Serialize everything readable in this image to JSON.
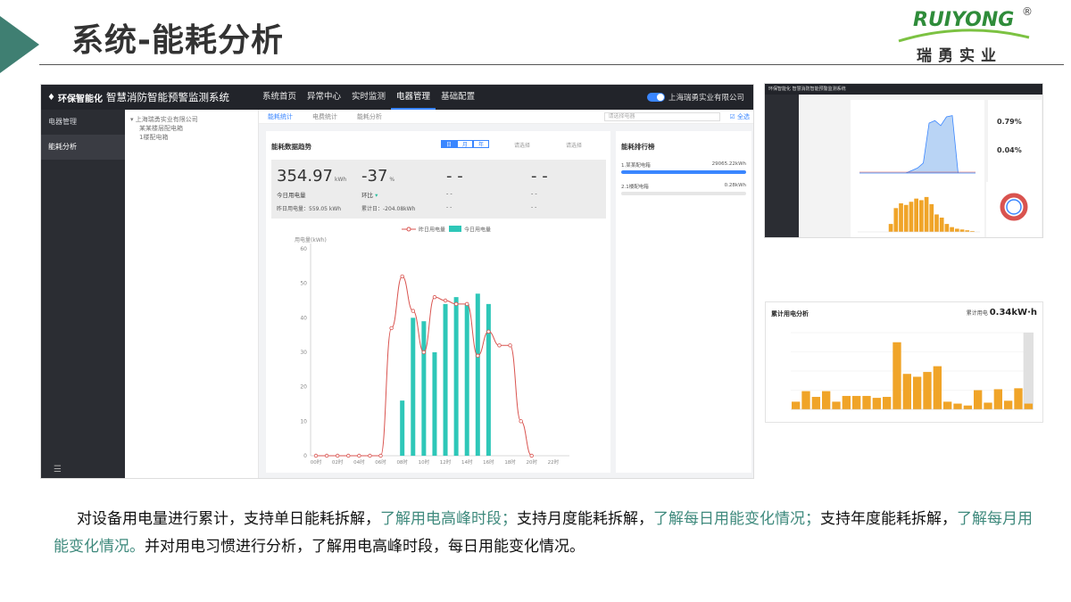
{
  "slide": {
    "title": "系统-能耗分析",
    "logo": {
      "word": "RUIYONG",
      "reg": "®",
      "cn": "瑞勇实业"
    },
    "accent_color": "#3f7f72",
    "highlight_color": "#3f8a7d"
  },
  "app": {
    "brand_name": "环保智能化",
    "system_title": "智慧消防智能预警监测系统",
    "nav": [
      "系统首页",
      "异常中心",
      "实时监测",
      "电器管理",
      "基础配置"
    ],
    "nav_active_index": 3,
    "company": "上海瑞勇实业有限公司",
    "sidebar": [
      "电器管理",
      "能耗分析"
    ],
    "sidebar_active_index": 1,
    "tree": [
      "上海瑞勇实业有限公司",
      "某某楼层配电箱",
      "1楼配电箱"
    ],
    "tabs": [
      "能耗统计",
      "电费统计",
      "能耗分析"
    ],
    "tabs_active_index": 0,
    "select_placeholder": "请选择电器",
    "select_all": "全选",
    "card_title": "能耗数据趋势",
    "segments": [
      "日",
      "月",
      "年"
    ],
    "segment_active_index": 0,
    "date_a": "请选择",
    "date_b": "请选择",
    "stats": [
      {
        "value": "354.97",
        "unit": "kWh",
        "label": "今日用电量",
        "foot": "昨日用电量：559.05 kWh"
      },
      {
        "value": "-37",
        "unit": "%",
        "label": "环比",
        "foot": "累计日：-204.08kWh"
      },
      {
        "value": "- -",
        "unit": "",
        "label": "- -",
        "foot": "- -"
      },
      {
        "value": "- -",
        "unit": "",
        "label": "- -",
        "foot": "- -"
      }
    ],
    "ranking_title": "能耗排行榜",
    "ranking": [
      {
        "name": "1.某某配电箱",
        "value": "29065.22kWh",
        "fraction": 1.0
      },
      {
        "name": "2.1楼配电箱",
        "value": "0.28kWh",
        "fraction": 0.0
      }
    ]
  },
  "chart_data": [
    {
      "type": "bar",
      "title": "",
      "ylabel": "用电量(kWh)",
      "ylim": [
        0,
        60
      ],
      "y_ticks": [
        0,
        10,
        20,
        30,
        40,
        50,
        60
      ],
      "x_ticks": [
        "00时",
        "02时",
        "04时",
        "06时",
        "08时",
        "10时",
        "12时",
        "14时",
        "16时",
        "18时",
        "20时",
        "22时"
      ],
      "legend": [
        "昨日用电量",
        "今日用电量"
      ],
      "legend_position": "top",
      "hours": [
        0,
        1,
        2,
        3,
        4,
        5,
        6,
        7,
        8,
        9,
        10,
        11,
        12,
        13,
        14,
        15,
        16,
        17,
        18,
        19,
        20,
        21,
        22,
        23
      ],
      "series": [
        {
          "name": "昨日用电量",
          "kind": "line",
          "color": "#d9534f",
          "values": [
            0,
            0,
            0,
            0,
            0,
            0,
            0,
            37,
            52,
            42,
            30,
            46,
            45,
            44,
            44,
            29,
            36,
            32,
            32,
            10,
            0
          ]
        },
        {
          "name": "今日用电量",
          "kind": "bar",
          "color": "#2ec7b8",
          "values": [
            0,
            0,
            0,
            0,
            0,
            0,
            0,
            0,
            16,
            40,
            39,
            30,
            44,
            46,
            44,
            47,
            44,
            0,
            0,
            0,
            0,
            0,
            0,
            0
          ]
        }
      ]
    },
    {
      "type": "bar",
      "title": "累计用电分析",
      "total_label": "累计用电",
      "total_value": "0.34kW·h",
      "color": "#f0a428",
      "values": [
        8,
        19,
        13,
        19,
        8,
        14,
        14,
        14,
        12,
        13,
        70,
        37,
        34,
        39,
        45,
        8,
        6,
        4,
        20,
        7,
        21,
        9,
        22,
        6
      ],
      "ylim": [
        0,
        80
      ]
    }
  ],
  "thumbnail_a": {
    "top_title": "环保智能化 智慧消防智能预警监测系统",
    "pct_1": "0.79%",
    "pct_2": "0.04%",
    "area_values": [
      0,
      0,
      0,
      0,
      0,
      0,
      0,
      0,
      0,
      2,
      4,
      8,
      40,
      42,
      38,
      45,
      46,
      0,
      0,
      0,
      0
    ],
    "bar_values": [
      0,
      0,
      0,
      0,
      0,
      0,
      10,
      30,
      36,
      34,
      38,
      42,
      40,
      44,
      35,
      22,
      18,
      10,
      6,
      4,
      3,
      2,
      1,
      0
    ],
    "donut_color": "#d9534f",
    "donut_inner_color": "#3a86ff"
  },
  "description": {
    "p1": "对设备用电量进行累计，支持单日能耗拆解，",
    "h1": "了解用电高峰时段；",
    "p2": "支持月度能耗拆解，",
    "h2": "了解每日用能变化情况；",
    "p3": "支持年度能耗拆解，",
    "h3": "了解每月用能变化情况。",
    "p4": "并对用电习惯进行分析，了解用电高峰时段，每日用能变化情况。"
  }
}
